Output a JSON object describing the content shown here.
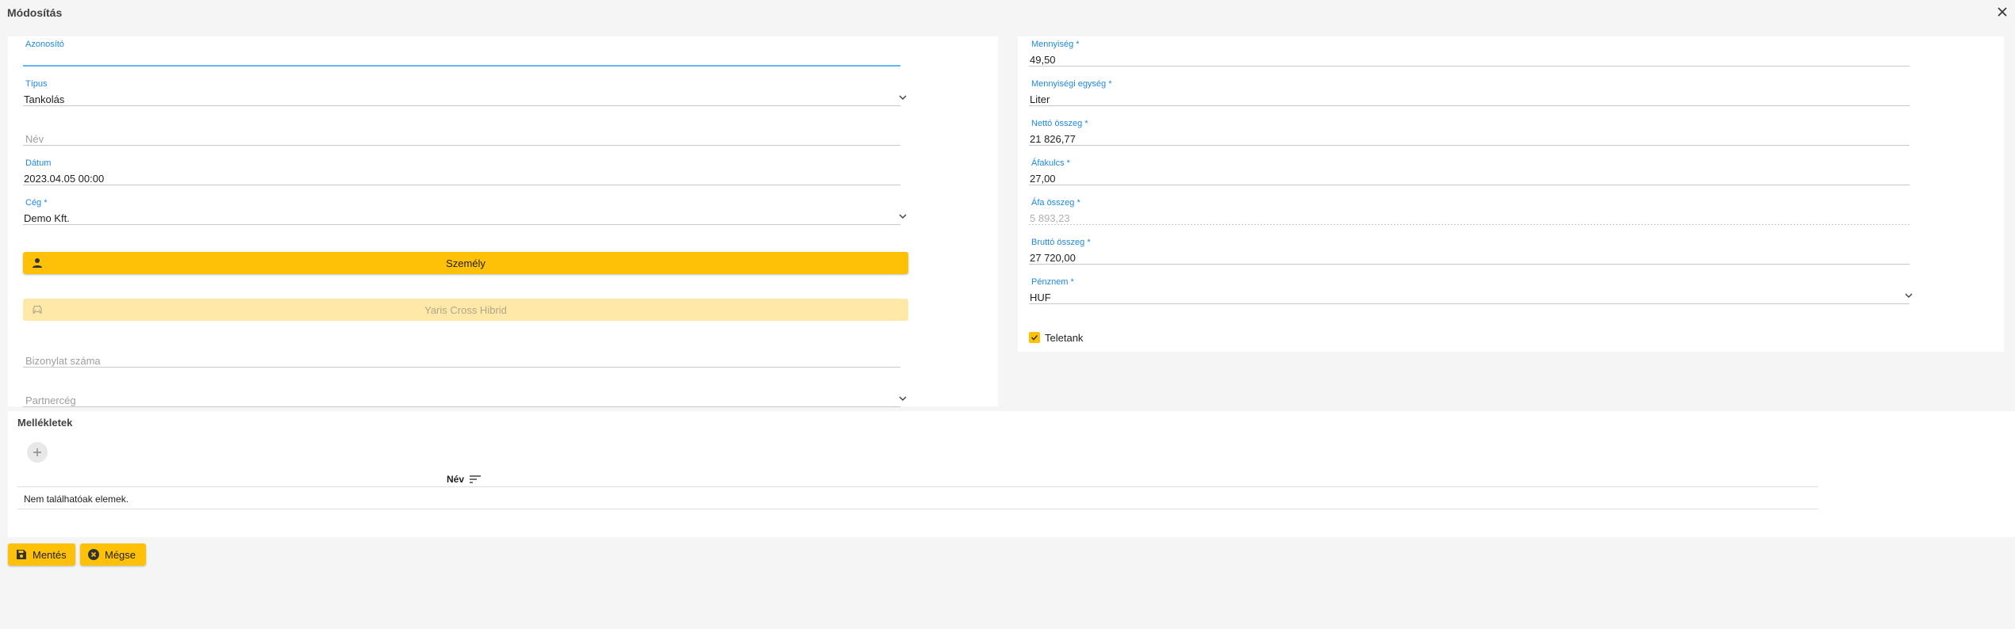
{
  "dialog": {
    "title": "Módosítás"
  },
  "left_form": {
    "azonosito": {
      "label": "Azonosító",
      "value": ""
    },
    "tipus": {
      "label": "Típus",
      "value": "Tankolás"
    },
    "nev": {
      "placeholder": "Név"
    },
    "datum": {
      "label": "Dátum",
      "value": "2023.04.05 00:00"
    },
    "ceg": {
      "label": "Cég *",
      "value": "Demo Kft."
    },
    "szemely_button": {
      "label": "Személy"
    },
    "vehicle_button": {
      "label": "Yaris Cross Hibrid"
    },
    "bizonylat": {
      "placeholder": "Bizonylat száma"
    },
    "partnerceg": {
      "placeholder": "Partnercég"
    }
  },
  "right_form": {
    "mennyiseg": {
      "label": "Mennyiség *",
      "value": "49,50"
    },
    "mennyisegi_egyseg": {
      "label": "Mennyiségi egység *",
      "value": "Liter"
    },
    "netto": {
      "label": "Nettó összeg *",
      "value": "21 826,77"
    },
    "afakulcs": {
      "label": "Áfakulcs *",
      "value": "27,00"
    },
    "afa_osszeg": {
      "label": "Áfa összeg *",
      "value": "5 893,23"
    },
    "brutto": {
      "label": "Bruttó összeg *",
      "value": "27 720,00"
    },
    "penznem": {
      "label": "Pénznem *",
      "value": "HUF"
    },
    "teletank": {
      "label": "Teletank",
      "checked": true
    }
  },
  "attachments": {
    "title": "Mellékletek",
    "column_name": "Név",
    "empty_text": "Nem találhatóak elemek."
  },
  "actions": {
    "save": "Mentés",
    "cancel": "Mégse"
  },
  "colors": {
    "accent": "#ffc107",
    "label_blue": "#1e88e5"
  }
}
